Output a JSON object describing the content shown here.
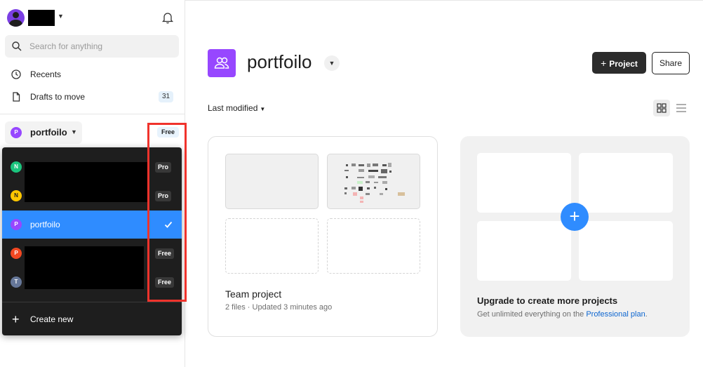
{
  "sidebar": {
    "search_placeholder": "Search for anything",
    "nav": [
      {
        "label": "Recents",
        "icon": "clock-icon"
      },
      {
        "label": "Drafts to move",
        "icon": "file-icon",
        "count": "31"
      }
    ],
    "current_team": {
      "initial": "P",
      "name": "portfoilo",
      "plan": "Free"
    }
  },
  "team_dropdown": {
    "teams": [
      {
        "initial": "N",
        "name": "",
        "plan": "Pro",
        "color": "#1bc47d",
        "redacted": true
      },
      {
        "initial": "N",
        "name": "",
        "plan": "Pro",
        "color": "#ffc700",
        "redacted": true
      },
      {
        "initial": "P",
        "name": "portfoilo",
        "plan": "",
        "color": "#9747ff",
        "selected": true
      },
      {
        "initial": "P",
        "name": "",
        "plan": "Free",
        "color": "#f24822",
        "redacted": true
      },
      {
        "initial": "T",
        "name": "",
        "plan": "Free",
        "color": "#667799",
        "redacted": true
      }
    ],
    "create_label": "Create new"
  },
  "header": {
    "title": "portfoilo",
    "project_button": "Project",
    "share_button": "Share"
  },
  "toolbar": {
    "sort_label": "Last modified"
  },
  "project_card": {
    "title": "Team project",
    "meta": "2 files · Updated 3 minutes ago"
  },
  "upgrade_card": {
    "title": "Upgrade to create more projects",
    "subtitle": "Get unlimited everything on the ",
    "link": "Professional plan",
    "suffix": "."
  },
  "colors": {
    "accent_blue": "#2f8cff",
    "team_purple": "#9747ff",
    "dark": "#1e1e1e",
    "highlight_red": "#f0332c"
  }
}
